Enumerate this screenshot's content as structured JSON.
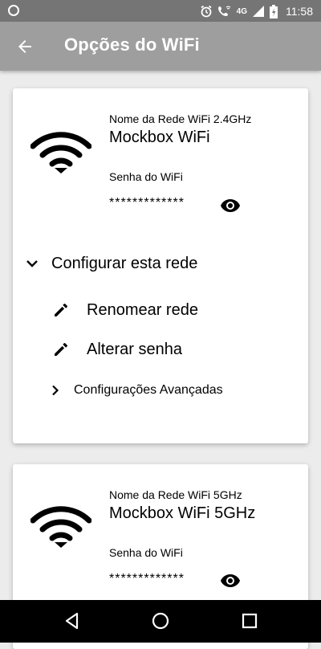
{
  "status_bar": {
    "time": "11:58",
    "network_badge": "4G",
    "icons": [
      "notification-circle-icon",
      "alarm-icon",
      "wifi-call-icon",
      "signal-icon",
      "battery-charging-icon"
    ]
  },
  "app_bar": {
    "title": "Opções do WiFi",
    "back_icon": "arrow-back-icon"
  },
  "networks": [
    {
      "label": "Nome da Rede WiFi 2.4GHz",
      "name": "Mockbox WiFi",
      "password_label": "Senha do WiFi",
      "password_value": "*************"
    },
    {
      "label": "Nome da Rede WiFi 5GHz",
      "name": "Mockbox WiFi 5GHz",
      "password_label": "Senha do WiFi",
      "password_value": "*************"
    }
  ],
  "configure": {
    "label": "Configurar esta rede",
    "expanded": true,
    "actions": [
      {
        "label": "Renomear rede",
        "icon": "pencil-icon"
      },
      {
        "label": "Alterar senha",
        "icon": "pencil-icon"
      }
    ],
    "advanced_label": "Configurações Avançadas"
  },
  "nav_bar": {
    "icons": [
      "back-triangle-icon",
      "home-circle-icon",
      "recents-square-icon"
    ]
  },
  "colors": {
    "status_bar": "#757575",
    "app_bar": "#9e9e9e",
    "background": "#ececec",
    "card": "#ffffff",
    "nav_bar": "#000000"
  }
}
